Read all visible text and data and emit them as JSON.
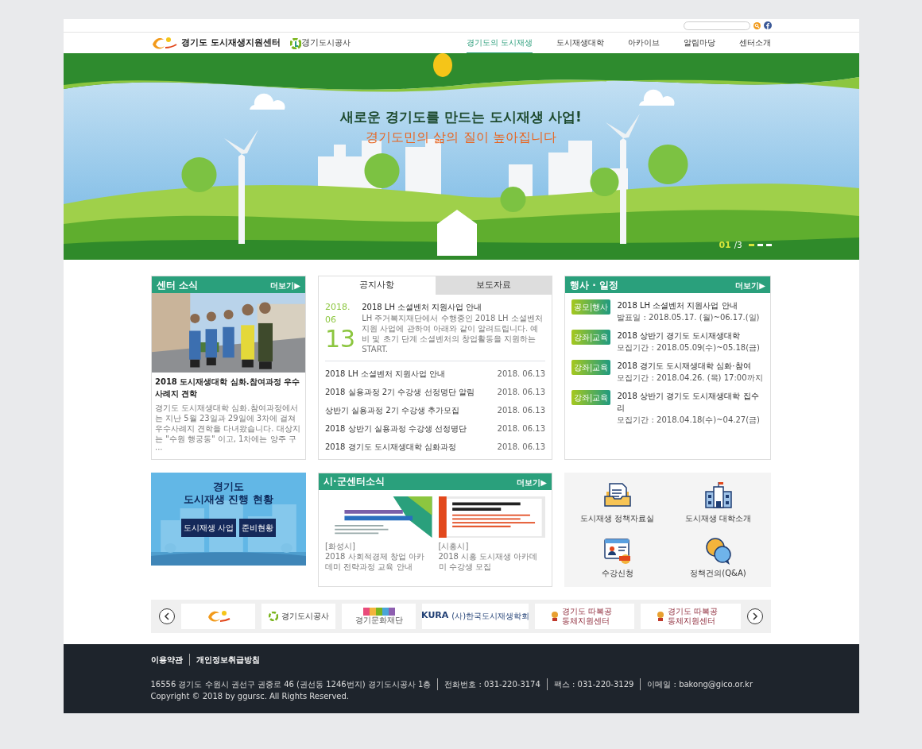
{
  "header": {
    "site_title": "경기도 도시재생지원센터",
    "partner_logo": {
      "big": "경기",
      "small": "도시공사"
    }
  },
  "nav": [
    {
      "label": "경기도의 도시재생",
      "selected": true
    },
    {
      "label": "도시재생대학",
      "selected": false
    },
    {
      "label": "아카이브",
      "selected": false
    },
    {
      "label": "알림마당",
      "selected": false
    },
    {
      "label": "센터소개",
      "selected": false
    }
  ],
  "hero": {
    "headline": "새로운 경기도를 만드는 도시재생 사업!",
    "subline": "경기도민의 삶의 질이 높아집니다",
    "current": "01",
    "total": "/3",
    "slides": [
      {
        "selected": true
      },
      {
        "selected": false
      },
      {
        "selected": false
      }
    ]
  },
  "center_news": {
    "title": "센터 소식",
    "more": "더보기▶",
    "headline": "2018 도시재생대학 심화.참여과정 우수사례지 견학",
    "summary": "경기도 도시재생대학 심화.참여과정에서는 지난 5월 23일과 29일에 3차에 걸쳐 우수사례지 견학을 다녀왔습니다. 대상지는 \"수원 행궁동\" 이고, 1차에는 양주 구···"
  },
  "notices": {
    "tabs": [
      {
        "label": "공지사항",
        "selected": true
      },
      {
        "label": "보도자료",
        "selected": false
      }
    ],
    "featured": {
      "year_month": "2018. 06",
      "day": "13",
      "title": "2018 LH 소셜벤처 지원사업 안내",
      "summary": "LH 주거복지재단에서 수행중인 2018 LH 소셜벤처 지원 사업에 관하여 아래와 같이 알려드립니다. 예비 및 초기 단계 소셜벤처의 창업활동을 지원하는 START."
    },
    "items": [
      {
        "title": "2018 LH 소셜벤처 지원사업 안내",
        "date": "2018. 06.13"
      },
      {
        "title": "2018 실용과정 2기 수강생 선정명단 알림",
        "date": "2018. 06.13"
      },
      {
        "title": "상반기 실용과정 2기 수강생 추가모집",
        "date": "2018. 06.13"
      },
      {
        "title": "2018 상반기 실용과정 수강생 선정명단",
        "date": "2018. 06.13"
      },
      {
        "title": "2018 경기도 도시재생대학 심화과정",
        "date": "2018. 06.13"
      }
    ]
  },
  "events": {
    "title": "행사 · 일정",
    "more": "더보기▶",
    "items": [
      {
        "tag": "공모|행사",
        "title": "2018 LH 소셜벤처 지원사업 안내",
        "period": "발표일 : 2018.05.17. (월)~06.17.(일)"
      },
      {
        "tag": "강좌|교육",
        "title": "2018 상반기 경기도 도시재생대학",
        "period": "모집기간 : 2018.05.09(수)~05.18(금)"
      },
      {
        "tag": "강좌|교육",
        "title": "2018 경기도 도시재생대학 심화·참여",
        "period": "모집기간 : 2018.04.26. (목) 17:00까지"
      },
      {
        "tag": "강좌|교육",
        "title": "2018 상반기 경기도 도시재생대학 집수리",
        "period": "모집기간 : 2018.04.18(수)~04.27(금)"
      }
    ]
  },
  "status_box": {
    "title_lines": [
      "경기도",
      "도시재생 진행 현황"
    ],
    "buttons": [
      "도시재생 사업",
      "준비현황"
    ]
  },
  "city_news": {
    "title": "시·군센터소식",
    "more": "더보기▶",
    "items": [
      {
        "region": "[화성시]",
        "text": "2018 사회적경제 창업 아카데미 전략과정 교육 안내"
      },
      {
        "region": "[시흥시]",
        "text": "2018 시흥 도시재생 아카데미 수강생 모집"
      }
    ]
  },
  "quick_links": [
    {
      "kind": "document",
      "label": "도시재생 정책자료실"
    },
    {
      "kind": "school",
      "label": "도시재생 대학소개"
    },
    {
      "kind": "apply",
      "label": "수강신청"
    },
    {
      "kind": "qna",
      "label": "정책건의(Q&A)"
    }
  ],
  "partners": [
    {
      "kind": "emblem"
    },
    {
      "kind": "corp",
      "text": "경기도시공사"
    },
    {
      "kind": "culture",
      "text": "경기문화재단"
    },
    {
      "kind": "kura",
      "text": "KURA",
      "sub": "(사)한국도시재생학회"
    },
    {
      "kind": "community",
      "text": "경기도 따복공동체지원센터"
    },
    {
      "kind": "community",
      "text": "경기도 따복공동체지원센터"
    }
  ],
  "footer": {
    "links": [
      "이용약관",
      "개인정보취급방침"
    ],
    "info": [
      "16556 경기도 수원시 권선구 권중로 46 (권선동 1246번지) 경기도시공사 1층",
      "전화번호 : 031-220-3174",
      "팩스 : 031-220-3129",
      "이메일 : bakong@gico.or.kr"
    ],
    "copyright": "Copyright © 2018 by ggursc. All Rights Reserved."
  }
}
